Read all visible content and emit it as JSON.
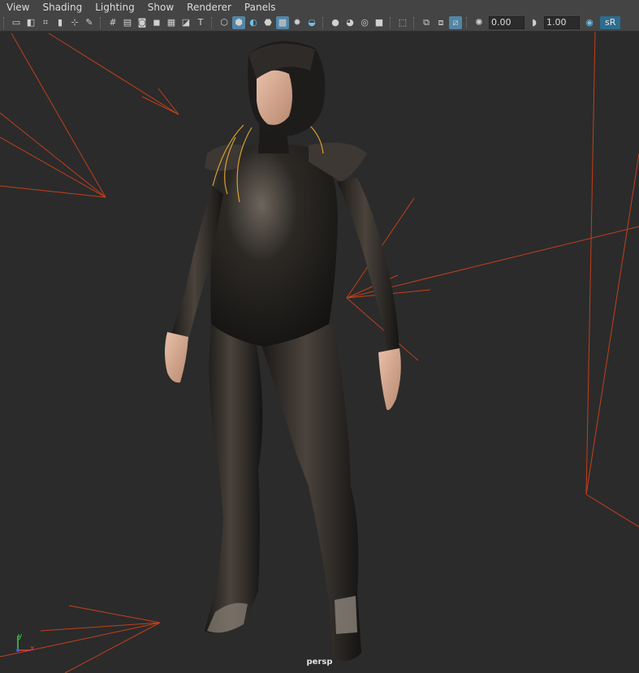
{
  "menu": {
    "items": [
      "View",
      "Shading",
      "Lighting",
      "Show",
      "Renderer",
      "Panels"
    ]
  },
  "toolbar": {
    "icons": {
      "g1": [
        "select-camera-icon",
        "camera-attributes-icon",
        "bookmarks-icon",
        "image-plane-icon",
        "2d-pan-zoom-icon",
        "grease-pencil-icon"
      ],
      "g2": [
        "grid-icon",
        "film-gate-icon",
        "resolution-gate-icon",
        "gate-mask-icon",
        "field-chart-icon",
        "safe-action-icon",
        "safe-title-icon"
      ],
      "g3": [
        "wireframe-icon",
        "smooth-shade-icon",
        "default-material-icon",
        "wireframe-on-shaded-icon",
        "xray-icon",
        "use-all-lights-icon",
        "shadows-icon"
      ],
      "g4": [
        "screen-space-ao-icon",
        "motion-blur-icon",
        "anti-aliasing-icon",
        "depth-of-field-icon"
      ],
      "g5": [
        "isolate-select-icon",
        "xray-joints-icon",
        "backface-culling-icon",
        "xray-active-icon"
      ]
    },
    "exposure_value": "0.00",
    "gamma_value": "1.00",
    "color_space_label": "sR"
  },
  "viewport": {
    "camera_label": "persp",
    "axis_y_label": "y",
    "axis_x_label": "x"
  },
  "colors": {
    "panel_bg": "#444444",
    "viewport_bg": "#2b2b2b",
    "light_lines": "#c2401a",
    "accent": "#5285a6"
  }
}
